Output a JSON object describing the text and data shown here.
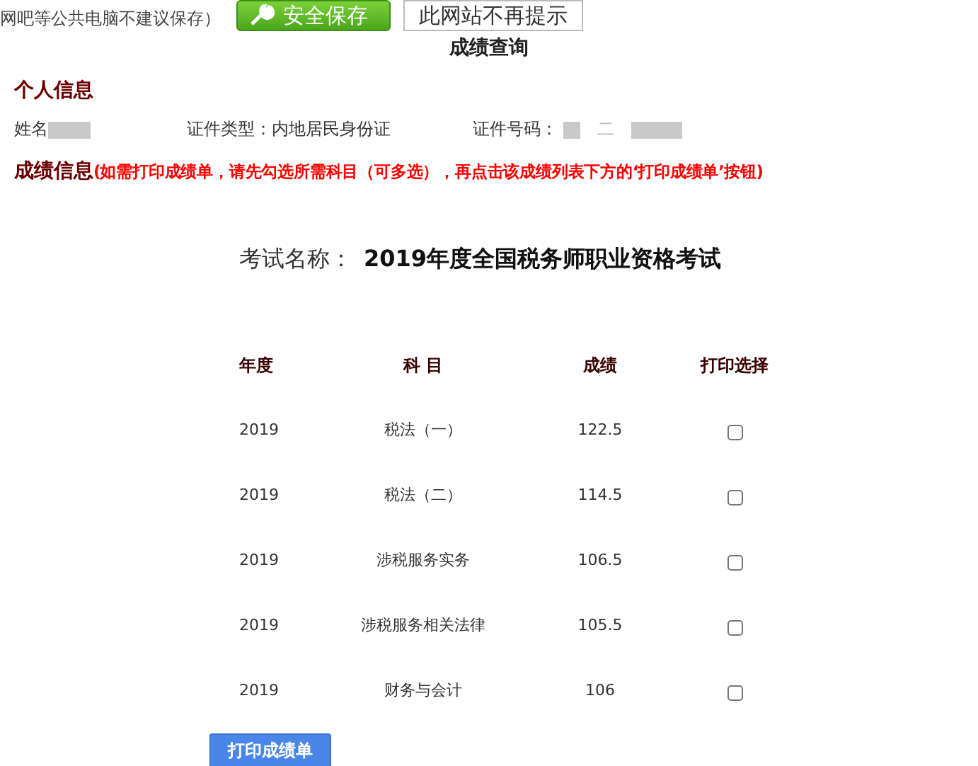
{
  "top_bar": {
    "note": "网吧等公共电脑不建议保存）",
    "save_button": "安全保存",
    "no_prompt_button": "此网站不再提示"
  },
  "title": "成绩查询",
  "personal": {
    "heading": "个人信息",
    "name_label": "姓名",
    "id_type_label": "证件类型：内地居民身份证",
    "id_number_label": "证件号码：",
    "id_number_visible": "二"
  },
  "scores": {
    "heading": "成绩信息",
    "hint": "(如需打印成绩单，请先勾选所需科目（可多选），再点击该成绩列表下方的‘打印成绩单’按钮)"
  },
  "exam": {
    "label": "考试名称：",
    "name": "2019年度全国税务师职业资格考试"
  },
  "table": {
    "columns": [
      "年度",
      "科 目",
      "成绩",
      "打印选择"
    ],
    "rows": [
      {
        "year": "2019",
        "subject": "税法（一）",
        "score": "122.5",
        "checked": false
      },
      {
        "year": "2019",
        "subject": "税法（二）",
        "score": "114.5",
        "checked": false
      },
      {
        "year": "2019",
        "subject": "涉税服务实务",
        "score": "106.5",
        "checked": false
      },
      {
        "year": "2019",
        "subject": "涉税服务相关法律",
        "score": "105.5",
        "checked": false
      },
      {
        "year": "2019",
        "subject": "财务与会计",
        "score": "106",
        "checked": false
      }
    ]
  },
  "print_button": "打印成绩单"
}
